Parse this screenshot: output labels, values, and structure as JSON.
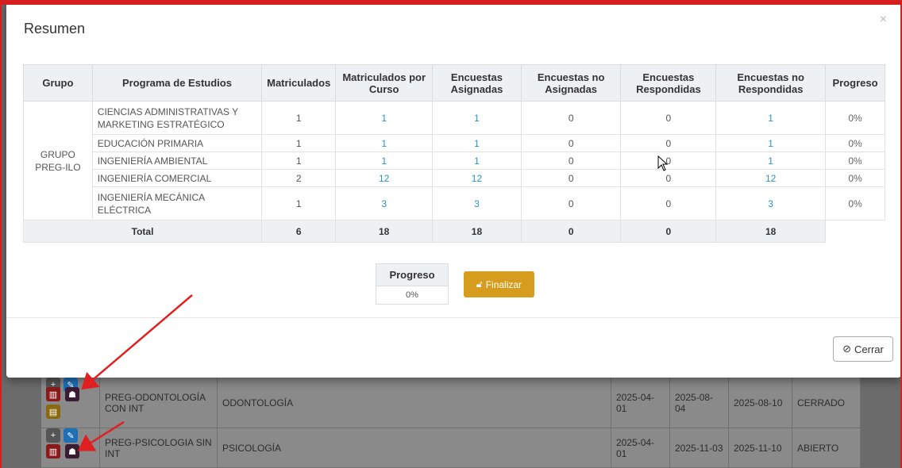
{
  "modal": {
    "title": "Resumen",
    "close_symbol": "×",
    "table": {
      "headers": [
        "Grupo",
        "Programa de Estudios",
        "Matriculados",
        "Matriculados por Curso",
        "Encuestas Asignadas",
        "Encuestas no Asignadas",
        "Encuestas Respondidas",
        "Encuestas no Respondidas",
        "Progreso"
      ],
      "group": "GRUPO PREG-ILO",
      "rows": [
        {
          "programa": "CIENCIAS ADMINISTRATIVAS Y MARKETING ESTRATÉGICO",
          "matriculados": "1",
          "por_curso": "1",
          "asignadas": "1",
          "no_asignadas": "0",
          "respondidas": "0",
          "no_respondidas": "1",
          "progreso": "0%"
        },
        {
          "programa": "EDUCACIÓN PRIMARIA",
          "matriculados": "1",
          "por_curso": "1",
          "asignadas": "1",
          "no_asignadas": "0",
          "respondidas": "0",
          "no_respondidas": "1",
          "progreso": "0%"
        },
        {
          "programa": "INGENIERÍA AMBIENTAL",
          "matriculados": "1",
          "por_curso": "1",
          "asignadas": "1",
          "no_asignadas": "0",
          "respondidas": "0",
          "no_respondidas": "1",
          "progreso": "0%"
        },
        {
          "programa": "INGENIERÍA COMERCIAL",
          "matriculados": "2",
          "por_curso": "12",
          "asignadas": "12",
          "no_asignadas": "0",
          "respondidas": "0",
          "no_respondidas": "12",
          "progreso": "0%"
        },
        {
          "programa": "INGENIERÍA MECÁNICA ELÉCTRICA",
          "matriculados": "1",
          "por_curso": "3",
          "asignadas": "3",
          "no_asignadas": "0",
          "respondidas": "0",
          "no_respondidas": "3",
          "progreso": "0%"
        }
      ],
      "total": {
        "label": "Total",
        "matriculados": "6",
        "por_curso": "18",
        "asignadas": "18",
        "no_asignadas": "0",
        "respondidas": "0",
        "no_respondidas": "18"
      }
    },
    "progress_box": {
      "label": "Progreso",
      "value": "0%"
    },
    "finalize_button": "Finalizar",
    "close_button": "Cerrar"
  },
  "background": {
    "rows": [
      {
        "grupo": "PREG-ODONTOLOGÍA CON INT",
        "programa": "ODONTOLOGÍA",
        "fecha1": "2025-04-01",
        "fecha2": "2025-08-04",
        "fecha3": "2025-08-10",
        "estado": "CERRADO"
      },
      {
        "grupo": "PREG-PSICOLOGIA SIN INT",
        "programa": "PSICOLOGÍA",
        "fecha1": "2025-04-01",
        "fecha2": "2025-11-03",
        "fecha3": "2025-11-10",
        "estado": "ABIERTO"
      }
    ]
  },
  "colors": {
    "accent_link": "#2a93c9",
    "finalize": "#d69c1d",
    "annotation_red": "#e02020"
  }
}
